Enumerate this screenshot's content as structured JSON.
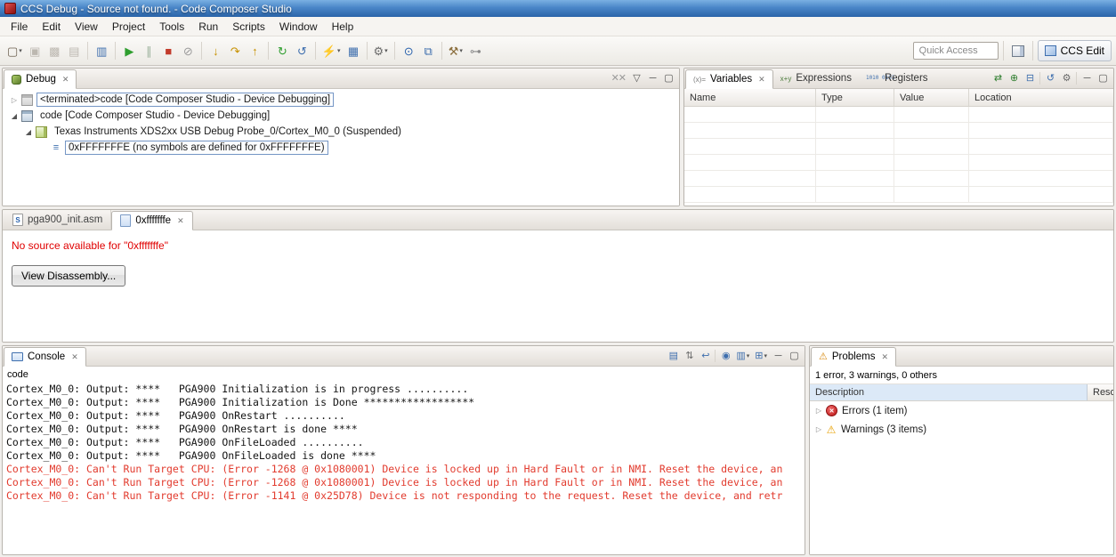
{
  "glyphs": {
    "close": "✕",
    "dropdown": "▾",
    "twisty_collapsed": "▷",
    "twisty_expanded": "◢",
    "stack_frame": "≡",
    "error_mark": "✕",
    "warning": "⚠"
  },
  "colors": {
    "titlebar_blue": "#2a64a8",
    "error_text": "#e23b2e",
    "no_source_text": "#e00000",
    "selection_outline": "#7596c5"
  },
  "titlebar": {
    "title": "CCS Debug - Source not found. - Code Composer Studio"
  },
  "menubar": {
    "items": [
      "File",
      "Edit",
      "View",
      "Project",
      "Tools",
      "Run",
      "Scripts",
      "Window",
      "Help"
    ]
  },
  "toolbar": {
    "quick_access": {
      "placeholder": "Quick Access",
      "value": ""
    },
    "perspectives": {
      "active_label": "CCS Edit"
    },
    "icons": [
      {
        "name": "new-button",
        "glyph": "▢",
        "color": "#6b5f4e",
        "dropdown": true
      },
      {
        "name": "save-button",
        "glyph": "▣",
        "color": "#b3aea6",
        "disabled": true
      },
      {
        "name": "save-all-button",
        "glyph": "▩",
        "color": "#b3aea6",
        "disabled": true
      },
      {
        "name": "print-button",
        "glyph": "▤",
        "color": "#b3aea6",
        "disabled": true
      },
      {
        "sep": true
      },
      {
        "name": "target-console-button",
        "glyph": "▥",
        "color": "#3f6fae"
      },
      {
        "sep": true
      },
      {
        "name": "resume-button",
        "glyph": "▶",
        "color": "#2f9e2f"
      },
      {
        "name": "suspend-button",
        "glyph": "∥",
        "color": "#9ab09a"
      },
      {
        "name": "terminate-button",
        "glyph": "■",
        "color": "#c23b2b"
      },
      {
        "name": "disconnect-button",
        "glyph": "⊘",
        "color": "#9a9a9a"
      },
      {
        "sep": true
      },
      {
        "name": "step-into-button",
        "glyph": "↓",
        "color": "#c79100"
      },
      {
        "name": "step-over-button",
        "glyph": "↷",
        "color": "#c79100"
      },
      {
        "name": "step-return-button",
        "glyph": "↑",
        "color": "#c79100"
      },
      {
        "sep": true
      },
      {
        "name": "restart-button",
        "glyph": "↻",
        "color": "#2f9e2f"
      },
      {
        "name": "refresh-button",
        "glyph": "↺",
        "color": "#3f6fae"
      },
      {
        "sep": true
      },
      {
        "name": "flash-button",
        "glyph": "⚡",
        "color": "#d8891a",
        "dropdown": true
      },
      {
        "name": "memory-button",
        "glyph": "▦",
        "color": "#3f6fae"
      },
      {
        "sep": true
      },
      {
        "name": "settings-button",
        "glyph": "⚙",
        "color": "#6b6b6b",
        "dropdown": true
      },
      {
        "sep": true
      },
      {
        "name": "search-button",
        "glyph": "⊙",
        "color": "#2a62ad"
      },
      {
        "name": "open-element-button",
        "glyph": "⧉",
        "color": "#3f6fae"
      },
      {
        "sep": true
      },
      {
        "name": "build-button",
        "glyph": "⚒",
        "color": "#8a6d3b",
        "dropdown": true
      },
      {
        "name": "key-button",
        "glyph": "⊶",
        "color": "#8a8a8a"
      }
    ]
  },
  "debug_view": {
    "tab": {
      "label": "Debug"
    },
    "toolbar_icons": [
      {
        "name": "remove-all-terminated-button",
        "glyph": "✕✕",
        "color": "#9a9a9a"
      },
      {
        "name": "view-menu-button",
        "glyph": "▽",
        "color": "#555555"
      },
      {
        "name": "minimize-button",
        "glyph": "─",
        "color": "#555555"
      },
      {
        "name": "maximize-button",
        "glyph": "▢",
        "color": "#555555"
      }
    ],
    "tree": [
      {
        "label": "<terminated>code [Code Composer Studio - Device Debugging]",
        "indent": 0,
        "state": "collapsed",
        "focused": true
      },
      {
        "label": "code [Code Composer Studio - Device Debugging]",
        "indent": 0,
        "state": "expanded"
      },
      {
        "label": "Texas Instruments XDS2xx USB Debug Probe_0/Cortex_M0_0 (Suspended)",
        "indent": 1,
        "state": "expanded"
      },
      {
        "label": "0xFFFFFFFE  (no symbols are defined for 0xFFFFFFFE)",
        "indent": 2,
        "state": "leaf",
        "focused": true
      }
    ]
  },
  "variables_view": {
    "tabs": [
      {
        "label": "Variables",
        "icon_text": "(x)=",
        "selected": true
      },
      {
        "label": "Expressions",
        "icon_text": "x+y",
        "selected": false
      },
      {
        "label": "Registers",
        "icon_text": "1010 0101",
        "selected": false
      }
    ],
    "toolbar_icons": [
      {
        "name": "show-type-names-button",
        "glyph": "⇄",
        "color": "#2f7e2f"
      },
      {
        "name": "add-watch-expression-button",
        "glyph": "⊕",
        "color": "#2f7e2f"
      },
      {
        "name": "collapse-all-button",
        "glyph": "⊟",
        "color": "#3f6fae"
      },
      {
        "sep": true
      },
      {
        "name": "refresh-variables-button",
        "glyph": "↺",
        "color": "#3f6fae"
      },
      {
        "name": "variables-settings-button",
        "glyph": "⚙",
        "color": "#6b6b6b"
      },
      {
        "sep": true
      },
      {
        "name": "minimize-button",
        "glyph": "─",
        "color": "#555555"
      },
      {
        "name": "maximize-button",
        "glyph": "▢",
        "color": "#555555"
      }
    ],
    "columns": [
      "Name",
      "Type",
      "Value",
      "Location"
    ],
    "rows": []
  },
  "editor": {
    "tabs": [
      {
        "label": "pga900_init.asm",
        "icon_letter": "S",
        "selected": false
      },
      {
        "label": "0xfffffffe",
        "icon_letter": "",
        "selected": true
      }
    ],
    "message": "No source available for \"0xfffffffe\"",
    "view_disassembly_button": "View Disassembly..."
  },
  "console_view": {
    "tab": {
      "label": "Console"
    },
    "toolbar_icons": [
      {
        "name": "clear-console-button",
        "glyph": "▤",
        "color": "#3f6fae"
      },
      {
        "name": "scroll-lock-button",
        "glyph": "⇅",
        "color": "#6b6b6b"
      },
      {
        "name": "word-wrap-button",
        "glyph": "↩",
        "color": "#3f6fae"
      },
      {
        "sep": true
      },
      {
        "name": "pin-console-button",
        "glyph": "◉",
        "color": "#3f6fae"
      },
      {
        "name": "display-selected-console-button",
        "glyph": "▥",
        "color": "#3f6fae",
        "dropdown": true
      },
      {
        "name": "open-console-button",
        "glyph": "⊞",
        "color": "#3f6fae",
        "dropdown": true
      },
      {
        "name": "minimize-button",
        "glyph": "─",
        "color": "#555555"
      },
      {
        "name": "maximize-button",
        "glyph": "▢",
        "color": "#555555"
      }
    ],
    "process_label": "code",
    "lines": [
      {
        "text": "Cortex_M0_0: Output: ****   PGA900 Initialization is in progress ..........",
        "stream": "stdout"
      },
      {
        "text": "Cortex_M0_0: Output: ****   PGA900 Initialization is Done ******************",
        "stream": "stdout"
      },
      {
        "text": "Cortex_M0_0: Output: ****   PGA900 OnRestart ..........",
        "stream": "stdout"
      },
      {
        "text": "Cortex_M0_0: Output: ****   PGA900 OnRestart is done ****",
        "stream": "stdout"
      },
      {
        "text": "Cortex_M0_0: Output: ****   PGA900 OnFileLoaded ..........",
        "stream": "stdout"
      },
      {
        "text": "Cortex_M0_0: Output: ****   PGA900 OnFileLoaded is done ****",
        "stream": "stdout"
      },
      {
        "text": "Cortex_M0_0: Can't Run Target CPU: (Error -1268 @ 0x1080001) Device is locked up in Hard Fault or in NMI. Reset the device, an",
        "stream": "stderr"
      },
      {
        "text": "Cortex_M0_0: Can't Run Target CPU: (Error -1268 @ 0x1080001) Device is locked up in Hard Fault or in NMI. Reset the device, an",
        "stream": "stderr"
      },
      {
        "text": "Cortex_M0_0: Can't Run Target CPU: (Error -1141 @ 0x25D78) Device is not responding to the request. Reset the device, and retr",
        "stream": "stderr"
      }
    ]
  },
  "problems_view": {
    "tab": {
      "label": "Problems"
    },
    "summary": "1 error, 3 warnings, 0 others",
    "columns": [
      "Description",
      "Resour"
    ],
    "groups": [
      {
        "label": "Errors (1 item)",
        "severity": "error"
      },
      {
        "label": "Warnings (3 items)",
        "severity": "warning"
      }
    ]
  }
}
